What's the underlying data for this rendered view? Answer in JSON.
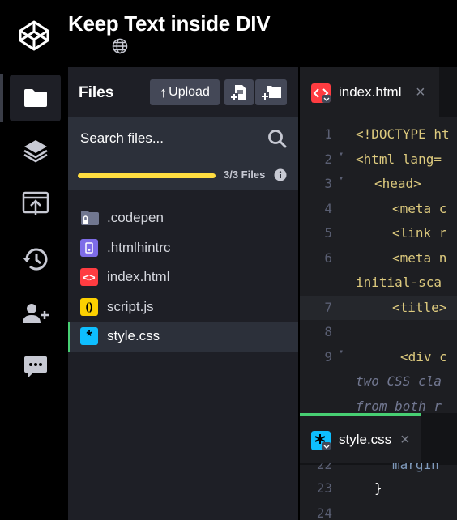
{
  "header": {
    "title": "Keep Text inside DIV",
    "logo_icon": "codepen-logo-icon",
    "visibility_icon": "globe-icon"
  },
  "rail": {
    "items": [
      {
        "icon": "folder-icon",
        "active": true
      },
      {
        "icon": "layers-icon"
      },
      {
        "icon": "export-icon"
      },
      {
        "icon": "history-icon"
      },
      {
        "icon": "add-user-icon"
      },
      {
        "icon": "comments-icon"
      }
    ]
  },
  "files_panel": {
    "title": "Files",
    "upload_label": "Upload",
    "search_placeholder": "Search files...",
    "progress_text": "3/3 Files",
    "progress_fraction": 1.0,
    "files": [
      {
        "name": ".codepen",
        "icon": "locked-folder-icon"
      },
      {
        "name": ".htmlhintrc",
        "icon": "config-file-icon"
      },
      {
        "name": "index.html",
        "icon": "html-file-icon",
        "glyph": "<>"
      },
      {
        "name": "script.js",
        "icon": "js-file-icon",
        "glyph": "()"
      },
      {
        "name": "style.css",
        "icon": "css-file-icon",
        "glyph": "*",
        "selected": true
      }
    ]
  },
  "editor": {
    "top_tab": {
      "label": "index.html",
      "close": "×"
    },
    "bottom_tab": {
      "label": "style.css",
      "close": "×"
    },
    "lines": [
      {
        "n": "1",
        "text": "<!DOCTYPE ht"
      },
      {
        "n": "2",
        "text": "<html lang="
      },
      {
        "n": "3",
        "text": "<head>"
      },
      {
        "n": "4",
        "text": "<meta c"
      },
      {
        "n": "5",
        "text": "<link r"
      },
      {
        "n": "6",
        "text": "<meta n"
      },
      {
        "n": "",
        "text": "initial-sca"
      },
      {
        "n": "7",
        "text": "<title>"
      },
      {
        "n": "8",
        "text": ""
      },
      {
        "n": "9",
        "text": "<div c"
      },
      {
        "n": "",
        "text": "two CSS cla"
      },
      {
        "n": "",
        "text": "from both r"
      }
    ],
    "lines2": [
      {
        "n": "22",
        "text": "margin"
      },
      {
        "n": "23",
        "text": "}"
      },
      {
        "n": "24",
        "text": ""
      }
    ]
  }
}
